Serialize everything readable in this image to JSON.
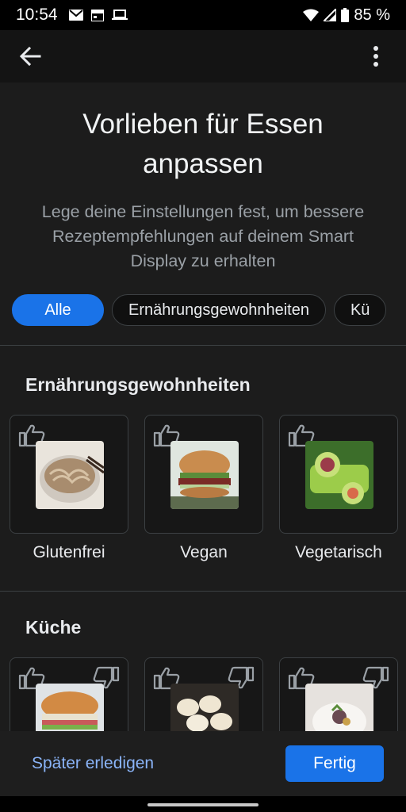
{
  "status": {
    "time": "10:54",
    "battery": "85 %"
  },
  "page": {
    "title": "Vorlieben für Essen anpassen",
    "subtitle": "Lege deine Einstellungen fest, um bessere Rezeptempfehlungen auf deinem Smart Display zu erhalten"
  },
  "chips": [
    {
      "label": "Alle",
      "selected": true
    },
    {
      "label": "Ernährungsgewohnheiten",
      "selected": false
    },
    {
      "label": "Kü",
      "selected": false
    }
  ],
  "sections": [
    {
      "title": "Ernährungsgewohnheiten",
      "items": [
        {
          "label": "Glutenfrei",
          "image": "noodle-bowl"
        },
        {
          "label": "Vegan",
          "image": "veggie-burger"
        },
        {
          "label": "Vegetarisch",
          "image": "green-wrap"
        }
      ]
    },
    {
      "title": "Küche",
      "items": [
        {
          "label": "",
          "image": "sandwich"
        },
        {
          "label": "",
          "image": "dumplings"
        },
        {
          "label": "",
          "image": "plated-dish"
        }
      ]
    }
  ],
  "actions": {
    "later": "Später erledigen",
    "done": "Fertig"
  },
  "colors": {
    "accent": "#1a73e8",
    "link": "#8ab4f8",
    "background": "#1c1c1c"
  }
}
